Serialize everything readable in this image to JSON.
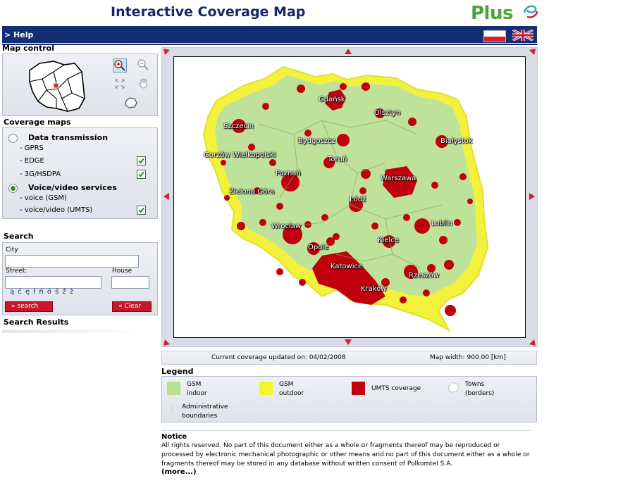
{
  "header": {
    "title": "Interactive Coverage Map",
    "logo_text": "Plus",
    "brand_green": "#4aa43a",
    "bar_color": "#142e74"
  },
  "topbar": {
    "help_label": "> Help"
  },
  "map_control": {
    "title": "Map control"
  },
  "coverage": {
    "title": "Coverage maps",
    "groups": [
      {
        "label": "Data transmission",
        "selected": false,
        "items": [
          {
            "label": "- GPRS",
            "checked": null
          },
          {
            "label": "- EDGE",
            "checked": true
          },
          {
            "label": "- 3G/HSDPA",
            "checked": true
          }
        ]
      },
      {
        "label": "Voice/video services",
        "selected": true,
        "items": [
          {
            "label": "- voice (GSM)",
            "checked": null
          },
          {
            "label": "- voice/video (UMTS)",
            "checked": true
          }
        ]
      }
    ]
  },
  "search": {
    "title": "Search",
    "city_label": "City",
    "street_label": "Street:",
    "house_label": "House",
    "city_value": "",
    "street_value": "",
    "house_value": "",
    "special_chars": "ą ć ę ł ń ó ś ź ż",
    "search_button": "» search",
    "clear_button": "« Clear"
  },
  "results": {
    "title": "Search Results"
  },
  "map": {
    "cities": [
      {
        "name": "Gdańsk"
      },
      {
        "name": "Olsztyn"
      },
      {
        "name": "Szczecin"
      },
      {
        "name": "Bydgoszcz"
      },
      {
        "name": "Białystok"
      },
      {
        "name": "Gorzów Wielkopolski"
      },
      {
        "name": "Toruń"
      },
      {
        "name": "Poznań"
      },
      {
        "name": "Warszawa"
      },
      {
        "name": "Zielona Góra"
      },
      {
        "name": "Łódź"
      },
      {
        "name": "Wrocław"
      },
      {
        "name": "Lublin"
      },
      {
        "name": "Kielce"
      },
      {
        "name": "Opole"
      },
      {
        "name": "Katowice"
      },
      {
        "name": "Rzeszów"
      },
      {
        "name": "Kraków"
      }
    ]
  },
  "status": {
    "updated": "Current coverage updated on: 04/02/2008",
    "width": "Map width: 900.00 [km]"
  },
  "legend": {
    "title": "Legend",
    "items": [
      {
        "line1": "GSM",
        "line2": "indoor",
        "color": "#b7e08f"
      },
      {
        "line1": "GSM",
        "line2": "outdoor",
        "color": "#f4f42a"
      },
      {
        "line1": "UMTS coverage",
        "line2": "",
        "color": "#c0000d"
      },
      {
        "line1": "Towns",
        "line2": "(borders)",
        "color": ""
      },
      {
        "line1": "Administrative",
        "line2": "boundaries",
        "color": ""
      }
    ]
  },
  "notice": {
    "title": "Notice",
    "text": "All rights reserved. No part of this document either as a whole or fragments thereof may be reproduced or processed by electronic mechanical photographic or other means and no part of this document either as a whole or fragments thereof may be stored in any database without written consent of Polkomtel S.A.",
    "more": "(more...)"
  }
}
